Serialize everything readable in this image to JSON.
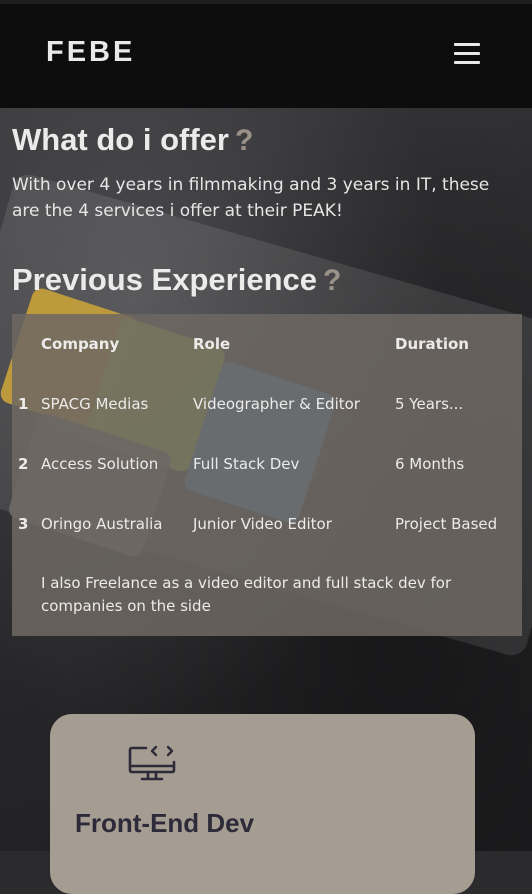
{
  "header": {
    "logo": "FEBE"
  },
  "offer": {
    "title": "What do i offer",
    "question_mark": "?",
    "text": "With over 4 years in filmmaking and 3 years in IT, these are the 4 services i offer at their PEAK!"
  },
  "experience": {
    "title": "Previous Experience",
    "question_mark": "?",
    "headers": {
      "company": "Company",
      "role": "Role",
      "duration": "Duration"
    },
    "rows": [
      {
        "num": "1",
        "company": "SPACG Medias",
        "role": "Videographer & Editor",
        "duration": "5 Years..."
      },
      {
        "num": "2",
        "company": "Access Solution",
        "role": "Full Stack Dev",
        "duration": "6 Months"
      },
      {
        "num": "3",
        "company": "Oringo Australia",
        "role": "Junior Video Editor",
        "duration": "Project Based"
      }
    ],
    "note": "I also Freelance as a video editor and full stack dev for companies on the side"
  },
  "services": [
    {
      "title": "Front-End Dev",
      "icon": "monitor-code-icon"
    }
  ],
  "colors": {
    "header_bg": "#0d0d0d",
    "panel_bg": "#6e6862",
    "card_bg": "#a69d92",
    "question_mark": "#9a9189",
    "card_title": "#2d2a3a"
  }
}
